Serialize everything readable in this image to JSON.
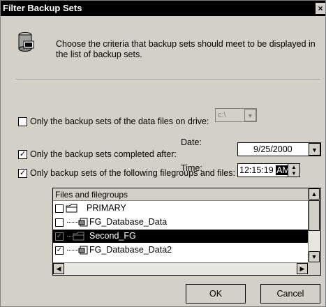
{
  "window": {
    "title": "Filter Backup Sets",
    "close_glyph": "×"
  },
  "header": {
    "description": "Choose the criteria that backup sets should meet to be displayed in the list of backup sets.",
    "icon": "database-filter-icon"
  },
  "option_drive": {
    "label": "Only the backup sets of the data files on drive:",
    "checked": false,
    "drive_value": "c:\\"
  },
  "option_date": {
    "label": "Only the backup sets completed after:",
    "checked": true,
    "date_label": "Date:",
    "date_value": "9/25/2000",
    "time_label": "Time:",
    "time_value": "12:15:19",
    "ampm_value": "AM"
  },
  "option_filegroups": {
    "label": "Only backup sets of the following filegroups and files:",
    "checked": true
  },
  "file_list": {
    "header": "Files and filegroups",
    "rows": [
      {
        "label": "PRIMARY",
        "checked": false,
        "type": "filegroup",
        "selected": false
      },
      {
        "label": "FG_Database_Data",
        "checked": false,
        "type": "file",
        "selected": false
      },
      {
        "label": "Second_FG",
        "checked": true,
        "type": "filegroup",
        "selected": true
      },
      {
        "label": "FG_Database_Data2",
        "checked": true,
        "type": "file",
        "selected": false
      }
    ]
  },
  "buttons": {
    "ok": "OK",
    "cancel": "Cancel"
  }
}
